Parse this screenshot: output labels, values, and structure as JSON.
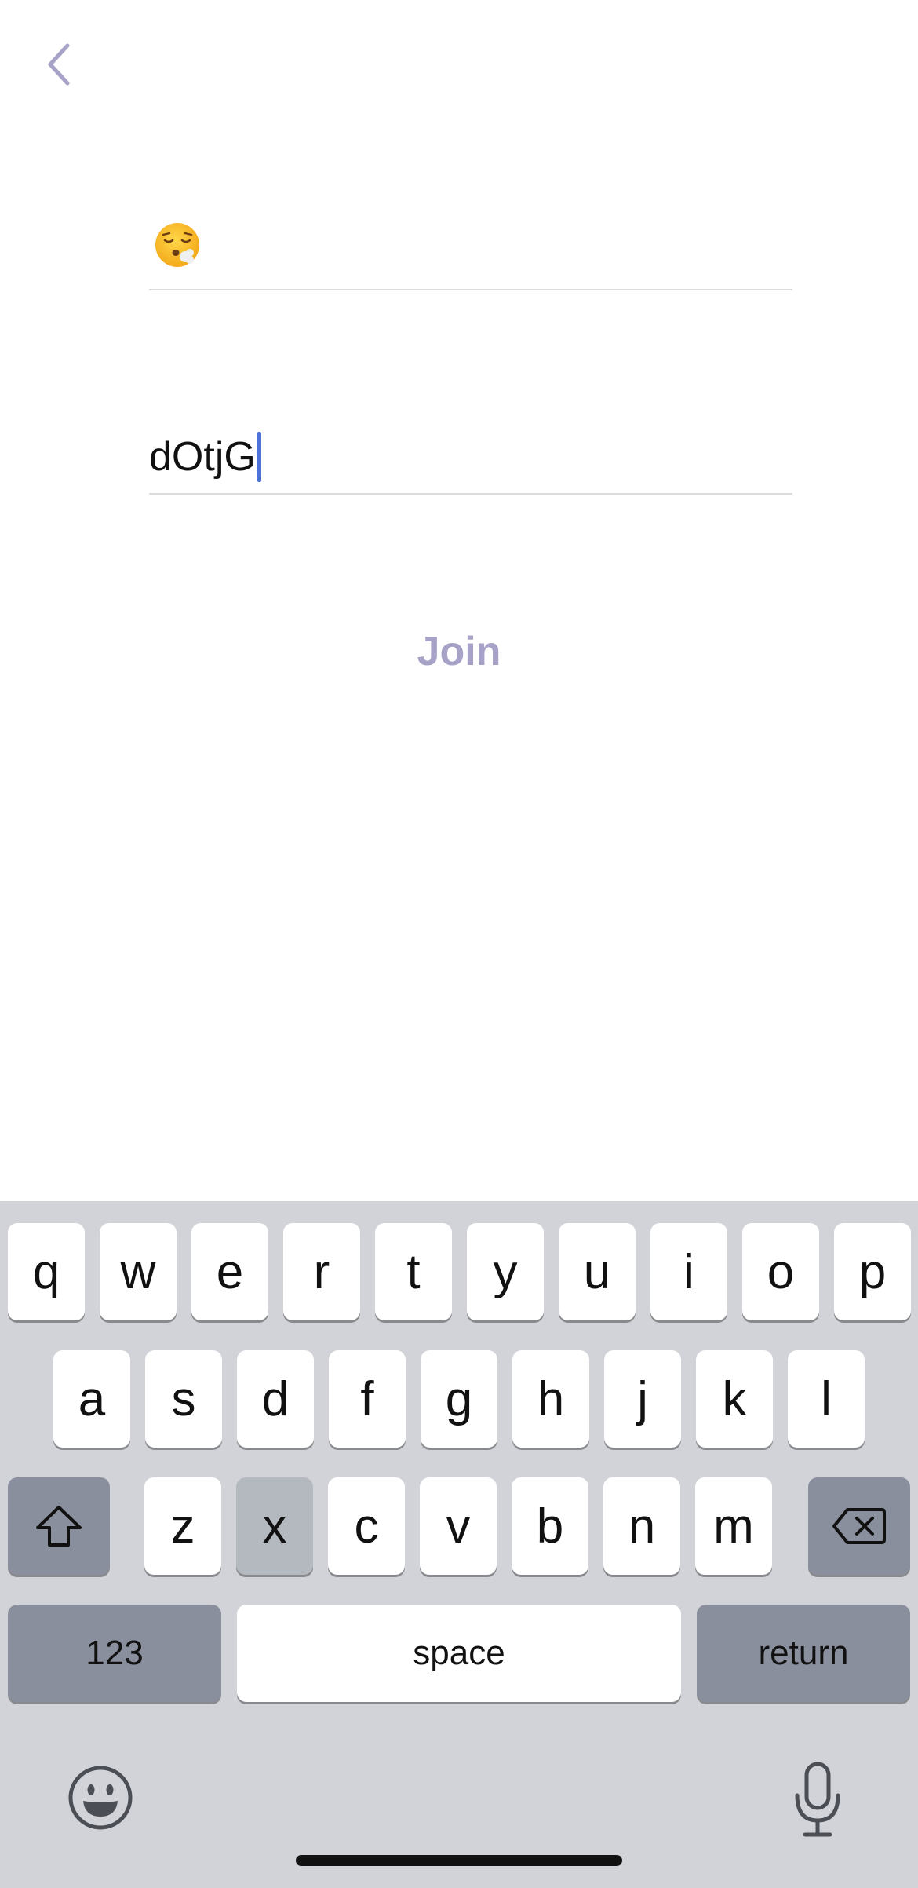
{
  "nav": {
    "back_icon": "chevron-left-icon"
  },
  "form": {
    "emoji_field": {
      "value_icon": "face-exhaling-emoji"
    },
    "code_field": {
      "value": "dOtjG"
    },
    "join_label": "Join"
  },
  "keyboard": {
    "row1": [
      "q",
      "w",
      "e",
      "r",
      "t",
      "y",
      "u",
      "i",
      "o",
      "p"
    ],
    "row2": [
      "a",
      "s",
      "d",
      "f",
      "g",
      "h",
      "j",
      "k",
      "l"
    ],
    "row3": [
      "z",
      "x",
      "c",
      "v",
      "b",
      "n",
      "m"
    ],
    "numbers_label": "123",
    "space_label": "space",
    "return_label": "return",
    "pressed_key": "x",
    "icons": {
      "shift": "shift-arrow-icon",
      "delete": "delete-backspace-icon",
      "emoji": "emoji-smiley-icon",
      "dictation": "microphone-icon"
    }
  },
  "colors": {
    "accent": "#a7a3c8",
    "caret": "#4a72d9",
    "keyboard_bg": "#d2d3d8",
    "dark_key": "#8a8f9e"
  }
}
